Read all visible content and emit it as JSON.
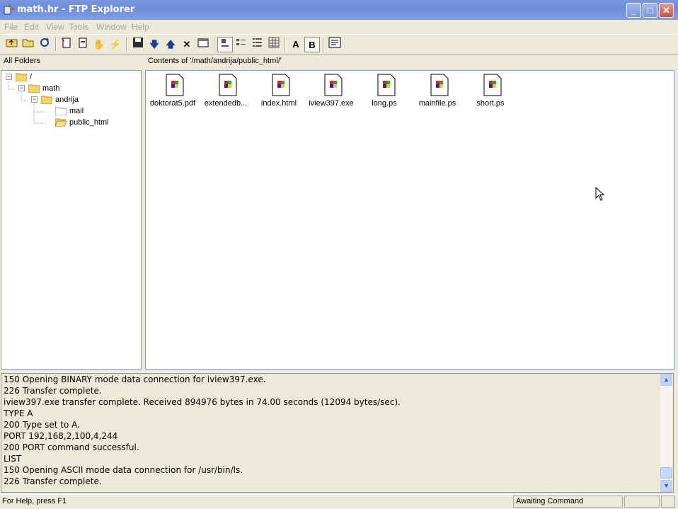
{
  "window": {
    "title": "math.hr - FTP Explorer"
  },
  "title_buttons": [
    "minimize",
    "maximize",
    "close"
  ],
  "menu": [
    "File",
    "Edit",
    "View",
    "Tools",
    "Window",
    "Help"
  ],
  "toolbar": {
    "icons": [
      "up-folder-icon",
      "open-folder-icon",
      "refresh-icon",
      "new-item-icon",
      "delete-item-icon",
      "hand-icon",
      "lightning-icon",
      "save-icon",
      "download-icon",
      "upload-icon",
      "delete-icon",
      "properties-icon",
      "large-icons-view-icon",
      "small-icons-view-icon",
      "list-view-icon",
      "details-view-icon"
    ],
    "mode_a": "A",
    "mode_b": "B",
    "log_icon": "log-icon"
  },
  "folders_header": "All Folders",
  "contents_header": "Contents of '/math/andrija/public_html/'",
  "tree": [
    {
      "label": "/",
      "level": 0,
      "expander": "−"
    },
    {
      "label": "math",
      "level": 1,
      "expander": "−"
    },
    {
      "label": "andrija",
      "level": 2,
      "expander": "−"
    },
    {
      "label": "mail",
      "level": 3,
      "expander": ""
    },
    {
      "label": "public_html",
      "level": 3,
      "expander": "",
      "open": true
    }
  ],
  "files": [
    "doktorat5.pdf",
    "extendedb...",
    "index.html",
    "iview397.exe",
    "long.ps",
    "mainfile.ps",
    "short.ps"
  ],
  "log": [
    "150 Opening BINARY mode data connection for iview397.exe.",
    "226 Transfer complete.",
    "iview397.exe transfer complete.  Received 894976 bytes in 74.00 seconds (12094 bytes/sec).",
    "TYPE A",
    "200 Type set to A.",
    "PORT 192,168,2,100,4,244",
    "200 PORT command successful.",
    "LIST",
    "150 Opening ASCII mode data connection for /usr/bin/ls.",
    "226 Transfer complete."
  ],
  "status": {
    "help": "For Help, press F1",
    "state": "Awaiting Command"
  }
}
